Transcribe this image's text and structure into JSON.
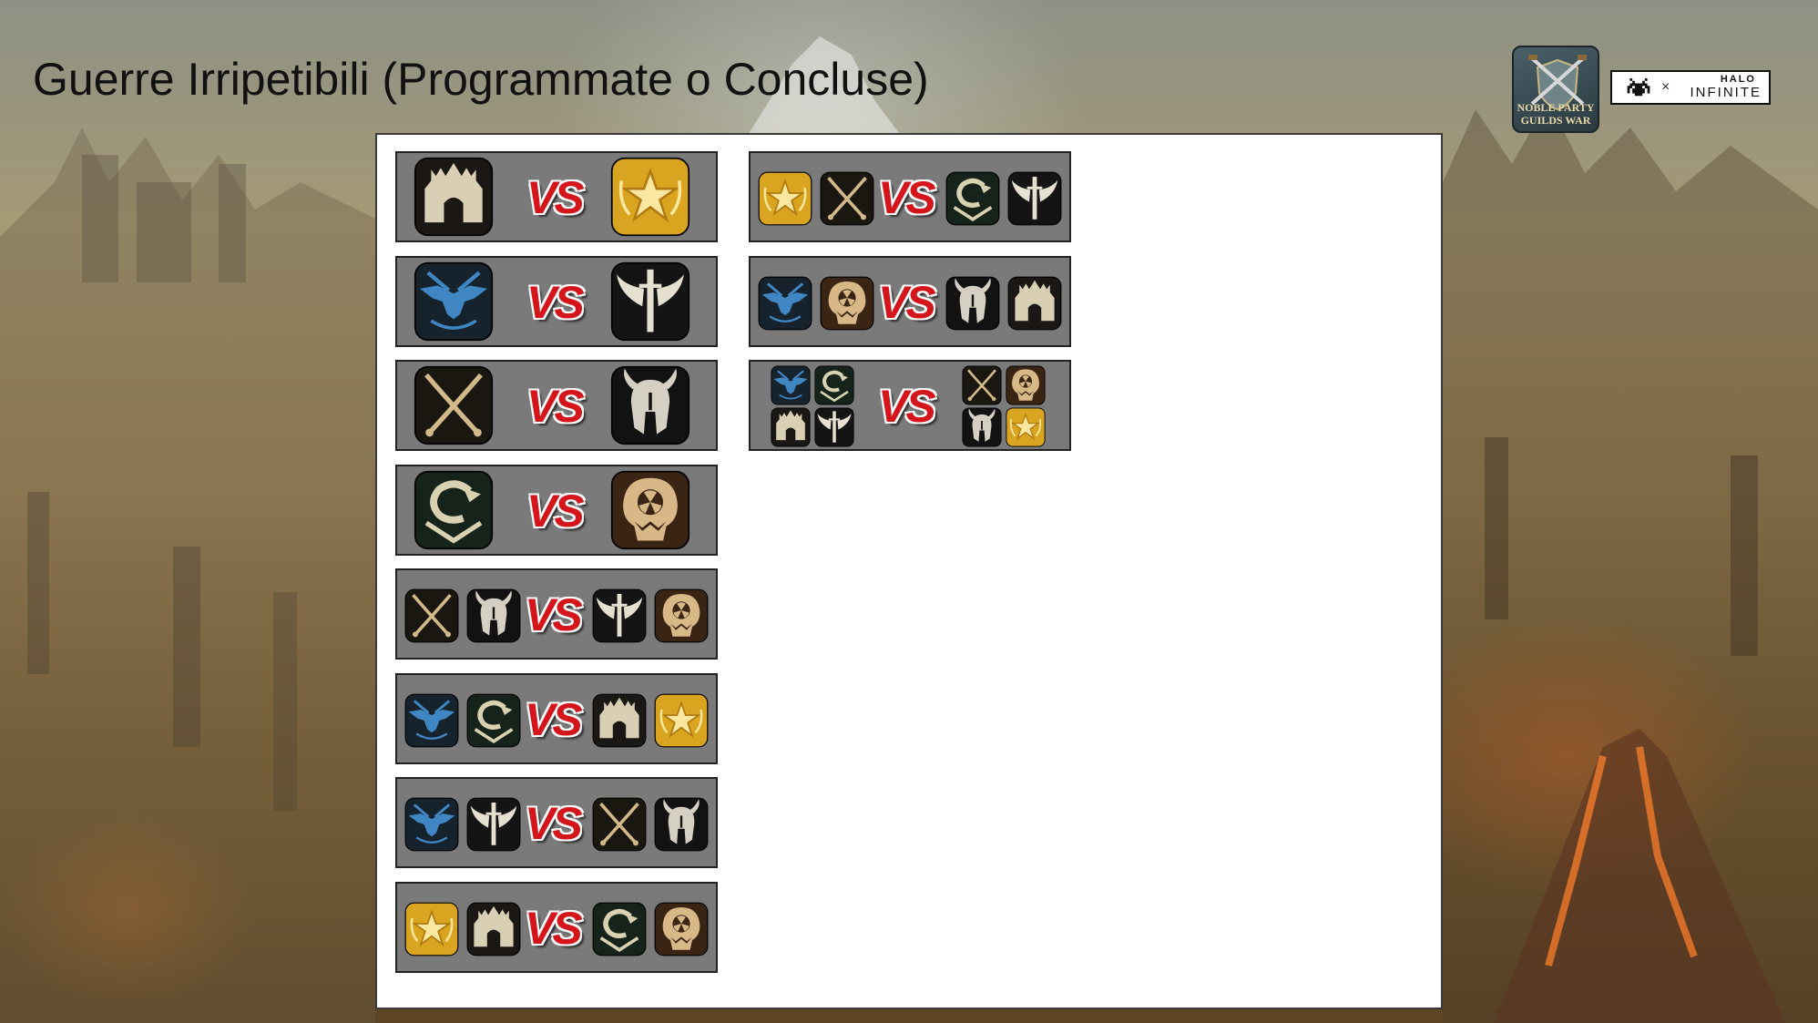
{
  "page": {
    "title": "Guerre Irripetibili (Programmate o Concluse)",
    "vs_label": "VS"
  },
  "logos": {
    "noble_line1": "NOBLE PARTY",
    "noble_line2": "GUILDS WAR",
    "times": "×",
    "halo": "HALO",
    "infinite": "INFINITE"
  },
  "colors": {
    "panel": "#ffffff",
    "card": "#7a7a7a",
    "vs": "#d4151b"
  },
  "guild_icons": {
    "castle": {
      "bg": "#1a1714",
      "fg": "#d9cfb4",
      "name": "castle-icon"
    },
    "star": {
      "bg": "#d9a520",
      "fg": "#fbe7a0",
      "name": "star-wings-icon"
    },
    "eagle": {
      "bg": "#16222c",
      "fg": "#3f86c2",
      "name": "eagle-swords-icon"
    },
    "winged-sword": {
      "bg": "#141414",
      "fg": "#e6e0d0",
      "name": "winged-sword-icon"
    },
    "crossed-swords": {
      "bg": "#1a1610",
      "fg": "#d2b98a",
      "name": "crossed-swords-icon"
    },
    "horned-helm": {
      "bg": "#121212",
      "fg": "#d6d0c4",
      "name": "horned-helmet-icon"
    },
    "serpent": {
      "bg": "#16231a",
      "fg": "#d9d2b2",
      "name": "serpent-icon"
    },
    "radiation-skull": {
      "bg": "#3a2414",
      "fg": "#d9b888",
      "name": "radiation-skull-icon"
    }
  },
  "matches_left": [
    {
      "left": [
        "castle"
      ],
      "right": [
        "star"
      ]
    },
    {
      "left": [
        "eagle"
      ],
      "right": [
        "winged-sword"
      ]
    },
    {
      "left": [
        "crossed-swords"
      ],
      "right": [
        "horned-helm"
      ]
    },
    {
      "left": [
        "serpent"
      ],
      "right": [
        "radiation-skull"
      ]
    },
    {
      "left": [
        "crossed-swords",
        "horned-helm"
      ],
      "right": [
        "winged-sword",
        "radiation-skull"
      ]
    },
    {
      "left": [
        "eagle",
        "serpent"
      ],
      "right": [
        "castle",
        "star"
      ]
    },
    {
      "left": [
        "eagle",
        "winged-sword"
      ],
      "right": [
        "crossed-swords",
        "horned-helm"
      ]
    },
    {
      "left": [
        "star",
        "castle"
      ],
      "right": [
        "serpent",
        "radiation-skull"
      ]
    }
  ],
  "matches_right": [
    {
      "left": [
        "star",
        "crossed-swords"
      ],
      "right": [
        "serpent",
        "winged-sword"
      ]
    },
    {
      "left": [
        "eagle",
        "radiation-skull"
      ],
      "right": [
        "horned-helm",
        "castle"
      ]
    },
    {
      "left": [
        "eagle",
        "serpent",
        "castle",
        "winged-sword"
      ],
      "right": [
        "crossed-swords",
        "radiation-skull",
        "horned-helm",
        "star"
      ]
    }
  ]
}
